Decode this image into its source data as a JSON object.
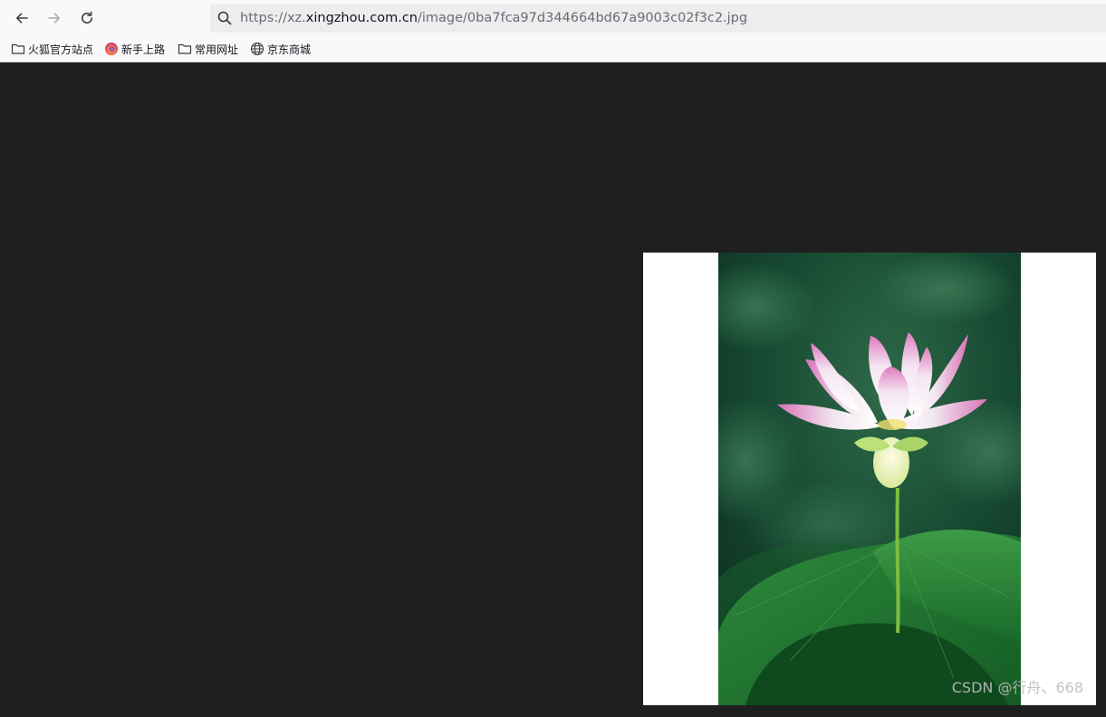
{
  "browser": {
    "url": {
      "prefix": "https://xz.",
      "host": "xingzhou.com.cn",
      "path": "/image/0ba7fca97d344664bd67a9003c02f3c2.jpg"
    },
    "nav": {
      "back_icon": "arrow-left-icon",
      "forward_icon": "arrow-right-icon",
      "reload_icon": "reload-icon"
    },
    "bookmarks": [
      {
        "label": "火狐官方站点",
        "icon": "folder-icon"
      },
      {
        "label": "新手上路",
        "icon": "firefox-icon"
      },
      {
        "label": "常用网址",
        "icon": "folder-icon"
      },
      {
        "label": "京东商城",
        "icon": "globe-icon"
      }
    ]
  },
  "viewer": {
    "background": "#1f1f1f",
    "image_subject": "pink-white lotus flower with green lotus leaves",
    "watermark": "CSDN @行舟、668"
  }
}
